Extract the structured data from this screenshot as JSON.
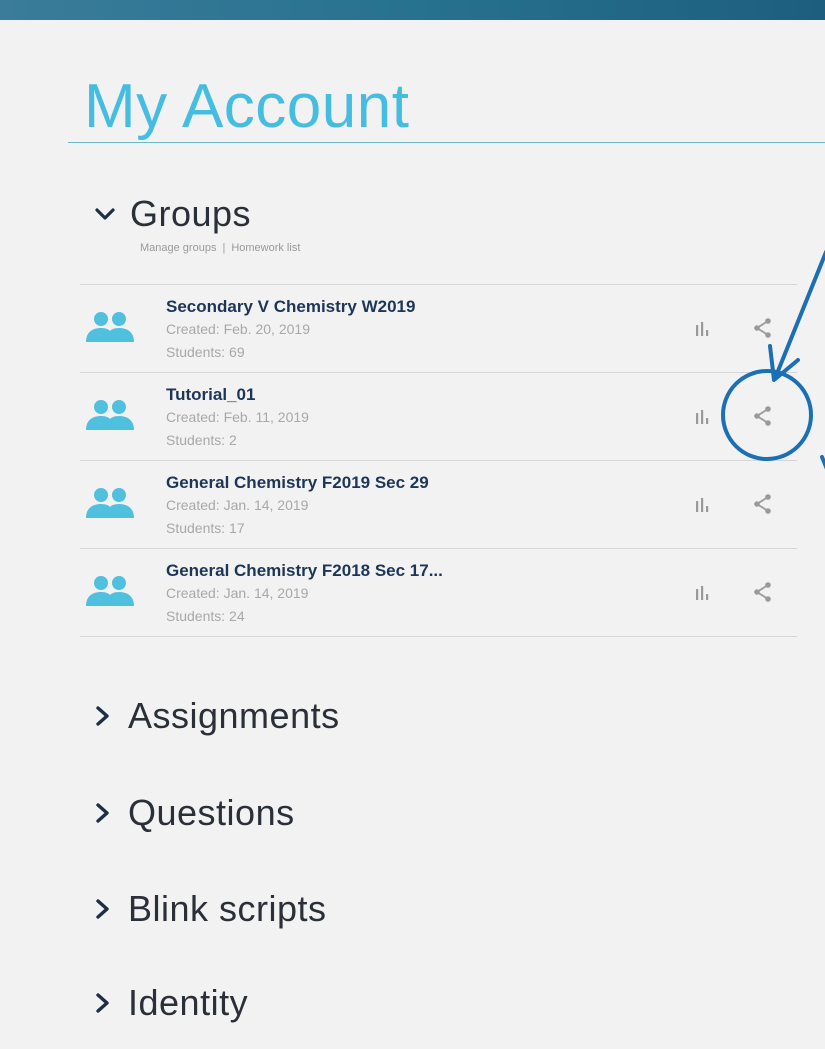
{
  "page": {
    "title": "My Account"
  },
  "groups": {
    "label": "Groups",
    "links": {
      "manage": "Manage groups",
      "separator": "|",
      "homework": "Homework list"
    },
    "items": [
      {
        "name": "Secondary V Chemistry W2019",
        "created": "Created: Feb. 20, 2019",
        "students": "Students: 69"
      },
      {
        "name": "Tutorial_01",
        "created": "Created: Feb. 11, 2019",
        "students": "Students: 2"
      },
      {
        "name": "General Chemistry F2019 Sec 29",
        "created": "Created: Jan. 14, 2019",
        "students": "Students: 17"
      },
      {
        "name": "General Chemistry F2018 Sec 17...",
        "created": "Created: Jan. 14, 2019",
        "students": "Students: 24"
      }
    ]
  },
  "sections": {
    "assignments": "Assignments",
    "questions": "Questions",
    "blink": "Blink scripts",
    "identity": "Identity"
  },
  "icons": {
    "group": "people-icon",
    "stats": "bar-chart-icon",
    "share": "share-icon",
    "expand": "chevron-down-icon",
    "collapse": "chevron-right-icon"
  },
  "colors": {
    "accent": "#45bde0",
    "group_name": "#1d3557",
    "annotation": "#1a6fb5",
    "top_bar": "#27728f"
  }
}
